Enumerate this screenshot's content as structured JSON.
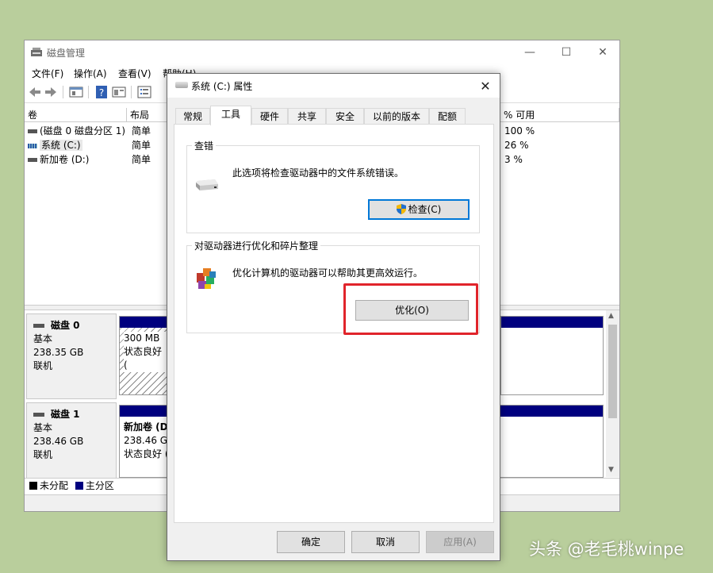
{
  "main_window": {
    "title": "磁盘管理",
    "controls": {
      "minimize": "—",
      "maximize": "☐",
      "close": "✕"
    },
    "menu": [
      "文件(F)",
      "操作(A)",
      "查看(V)",
      "帮助(H)"
    ],
    "columns": {
      "volume": "卷",
      "layout": "布局",
      "pct_free": "% 可用"
    },
    "volumes": [
      {
        "name": "(磁盘 0 磁盘分区 1)",
        "layout": "简单",
        "pct_free": "100 %"
      },
      {
        "name": "系统 (C:)",
        "layout": "简单",
        "pct_free": "26 %"
      },
      {
        "name": "新加卷 (D:)",
        "layout": "简单",
        "pct_free": "3 %"
      }
    ],
    "disks": [
      {
        "name": "磁盘 0",
        "type": "基本",
        "size": "238.35 GB",
        "status": "联机",
        "partition_size": "300 MB",
        "partition_status": "状态良好 ("
      },
      {
        "name": "磁盘 1",
        "type": "基本",
        "size": "238.46 GB",
        "status": "联机",
        "partition_name": "新加卷 (D",
        "partition_size": "238.46 GE",
        "partition_status": "状态良好 ("
      }
    ],
    "legend": {
      "unallocated": "未分配",
      "primary": "主分区"
    }
  },
  "dialog": {
    "title": "系统 (C:) 属性",
    "close": "✕",
    "tabs": [
      "常规",
      "工具",
      "硬件",
      "共享",
      "安全",
      "以前的版本",
      "配额"
    ],
    "active_tab": "工具",
    "error_check": {
      "title": "查错",
      "desc": "此选项将检查驱动器中的文件系统错误。",
      "button": "检查(C)"
    },
    "optimize": {
      "title": "对驱动器进行优化和碎片整理",
      "desc": "优化计算机的驱动器可以帮助其更高效运行。",
      "button": "优化(O)"
    },
    "buttons": {
      "ok": "确定",
      "cancel": "取消",
      "apply": "应用(A)"
    }
  },
  "colors": {
    "highlight": "#e0242b",
    "primary_partition": "#00007f",
    "desktop": "#b9ce9c"
  },
  "watermark": "头条 @老毛桃winpe"
}
